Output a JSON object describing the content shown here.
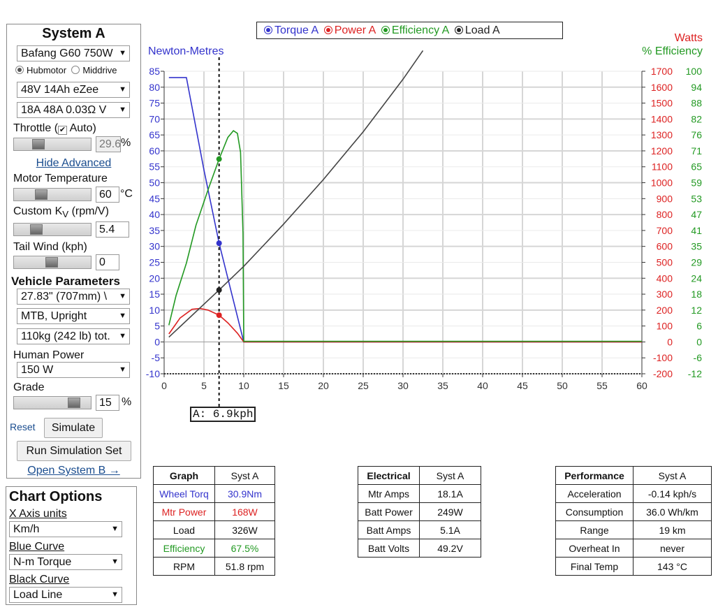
{
  "system_a": {
    "title": "System A",
    "motor": "Bafang G60 750W",
    "motor_type": {
      "hub": "Hubmotor",
      "mid": "Middrive",
      "selected": "hub"
    },
    "battery": "48V 14Ah eZee",
    "controller": "18A 48A 0.03Ω V",
    "throttle_label": "Throttle (",
    "throttle_auto": "Auto)",
    "throttle_check": "✔",
    "throttle_value": "29.6",
    "throttle_unit": "%",
    "throttle_level": 0.29,
    "hide_advanced": "Hide Advanced",
    "motor_temp_label": "Motor Temperature",
    "motor_temp_value": "60",
    "motor_temp_unit": "°C",
    "motor_temp_level": 0.33,
    "kv_label": "Custom K",
    "kv_sub": "V",
    "kv_suffix": " (rpm/V)",
    "kv_value": "5.4",
    "kv_level": 0.25,
    "tailwind_label": "Tail Wind (kph)",
    "tailwind_value": "0",
    "tailwind_level": 0.5,
    "vehicle_title": "Vehicle Parameters",
    "wheel": "27.83\" (707mm)  \\",
    "position": "MTB, Upright",
    "weight": "110kg (242 lb) tot.",
    "human_power_label": "Human Power",
    "human_power": "150 W",
    "grade_label": "Grade",
    "grade_value": "15",
    "grade_unit": "%",
    "grade_level": 0.85,
    "reset": "Reset",
    "simulate": "Simulate",
    "run_set": "Run Simulation Set",
    "open_b": "Open System B →"
  },
  "chart_options": {
    "title": "Chart Options",
    "x_units_label": "X Axis units",
    "x_units": "Km/h",
    "blue_label": "Blue Curve",
    "blue": "N-m Torque",
    "black_label": "Black Curve",
    "black": "Load Line"
  },
  "arrow": "▼",
  "legend": [
    {
      "name": "Torque A",
      "color": "#3333cc"
    },
    {
      "name": "Power A",
      "color": "#dd2222"
    },
    {
      "name": "Efficiency A",
      "color": "#229922"
    },
    {
      "name": "Load A",
      "color": "#222222"
    }
  ],
  "chart_data": {
    "type": "line",
    "left_axis_label": "Newton-Metres",
    "right_axis_label_1": "Watts",
    "right_axis_label_2": "% Efficiency",
    "xlim": [
      0,
      60
    ],
    "x_ticks": [
      0,
      5,
      10,
      15,
      20,
      25,
      30,
      35,
      40,
      45,
      50,
      55,
      60
    ],
    "left_ylim": [
      -10,
      85
    ],
    "left_ticks": [
      85,
      80,
      75,
      70,
      65,
      60,
      55,
      50,
      45,
      40,
      35,
      30,
      25,
      20,
      15,
      10,
      5,
      0,
      -5,
      -10
    ],
    "watts_ylim": [
      -200,
      1700
    ],
    "watts_ticks": [
      1700,
      1600,
      1500,
      1400,
      1300,
      1200,
      1100,
      1000,
      900,
      800,
      700,
      600,
      500,
      400,
      300,
      200,
      100,
      0,
      -100,
      -200
    ],
    "eff_ticks": [
      100,
      94,
      88,
      82,
      76,
      71,
      65,
      59,
      53,
      47,
      41,
      35,
      29,
      24,
      18,
      12,
      6,
      0,
      -6,
      -12
    ],
    "cursor_x": 6.9,
    "cursor_label": "A: 6.9kph",
    "series": [
      {
        "name": "Torque A",
        "axis": "left",
        "color": "#3333cc",
        "x": [
          0.6,
          2.0,
          2.8,
          5.0,
          6.9,
          8.5,
          10.0,
          60
        ],
        "y": [
          83,
          83,
          83,
          54,
          31,
          15,
          0,
          0
        ]
      },
      {
        "name": "Power A",
        "axis": "watts",
        "color": "#dd2222",
        "x": [
          0.6,
          2.0,
          3.5,
          4.5,
          5.5,
          6.9,
          8.0,
          9.2,
          10.0,
          60
        ],
        "y": [
          50,
          150,
          205,
          210,
          200,
          168,
          120,
          55,
          0,
          0
        ]
      },
      {
        "name": "Efficiency A",
        "axis": "eff",
        "color": "#229922",
        "x": [
          0.6,
          1.5,
          2.8,
          4.0,
          5.5,
          6.9,
          8.0,
          8.7,
          9.2,
          9.6,
          9.9,
          10.0,
          60
        ],
        "y": [
          6,
          17,
          29,
          43,
          56,
          67.5,
          75.5,
          78,
          77,
          70,
          40,
          0,
          0
        ]
      },
      {
        "name": "Load A",
        "axis": "watts",
        "color": "#444444",
        "x": [
          0.6,
          6.9,
          10,
          15,
          20,
          25,
          30,
          32.5
        ],
        "y": [
          30,
          326,
          475,
          740,
          1020,
          1320,
          1650,
          1830
        ]
      }
    ],
    "markers": [
      {
        "axis": "left",
        "x": 6.9,
        "y": 31,
        "color": "#3333cc"
      },
      {
        "axis": "watts",
        "x": 6.9,
        "y": 168,
        "color": "#dd2222"
      },
      {
        "axis": "eff",
        "x": 6.9,
        "y": 67.5,
        "color": "#229922"
      },
      {
        "axis": "watts",
        "x": 6.9,
        "y": 326,
        "color": "#222222"
      }
    ]
  },
  "graph_table": {
    "headers": [
      "Graph",
      "Syst A"
    ],
    "rows": [
      {
        "label": "Wheel Torq",
        "value": "30.9Nm",
        "color": "#3333cc"
      },
      {
        "label": "Mtr Power",
        "value": "168W",
        "color": "#dd2222"
      },
      {
        "label": "Load",
        "value": "326W",
        "color": "#111111"
      },
      {
        "label": "Efficiency",
        "value": "67.5%",
        "color": "#229922"
      },
      {
        "label": "RPM",
        "value": "51.8 rpm",
        "color": "#111111"
      }
    ]
  },
  "electrical_table": {
    "headers": [
      "Electrical",
      "Syst A"
    ],
    "rows": [
      {
        "label": "Mtr Amps",
        "value": "18.1A"
      },
      {
        "label": "Batt Power",
        "value": "249W"
      },
      {
        "label": "Batt Amps",
        "value": "5.1A"
      },
      {
        "label": "Batt Volts",
        "value": "49.2V"
      }
    ]
  },
  "performance_table": {
    "headers": [
      "Performance",
      "Syst A"
    ],
    "rows": [
      {
        "label": "Acceleration",
        "value": "-0.14 kph/s"
      },
      {
        "label": "Consumption",
        "value": "36.0 Wh/km"
      },
      {
        "label": "Range",
        "value": "19 km"
      },
      {
        "label": "Overheat In",
        "value": "never"
      },
      {
        "label": "Final Temp",
        "value": "143 °C"
      }
    ]
  }
}
